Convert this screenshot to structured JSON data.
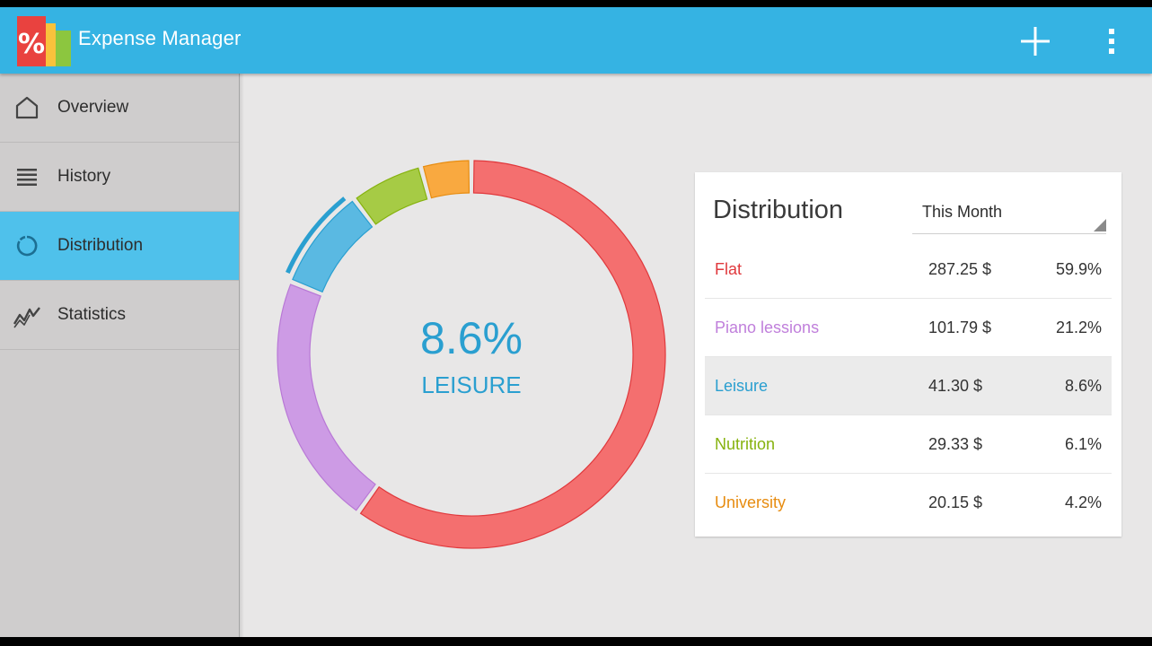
{
  "app": {
    "title": "Expense Manager"
  },
  "colors": {
    "accent": "#35b3e3",
    "active_nav": "#4fc1eb",
    "flat": "#f46f6f",
    "piano": "#cd9be5",
    "leisure": "#5ab9e2",
    "nutrition": "#a6cb45",
    "university": "#f9a940"
  },
  "toolbar": {
    "add_icon": "plus-icon",
    "menu_icon": "overflow-menu-icon"
  },
  "nav": {
    "items": [
      {
        "label": "Overview",
        "icon": "home-icon",
        "active": false
      },
      {
        "label": "History",
        "icon": "list-icon",
        "active": false
      },
      {
        "label": "Distribution",
        "icon": "donut-icon",
        "active": true
      },
      {
        "label": "Statistics",
        "icon": "trend-icon",
        "active": false
      }
    ]
  },
  "center": {
    "percent": "8.6%",
    "label": "LEISURE"
  },
  "distribution": {
    "title": "Distribution",
    "period": "This Month",
    "rows": [
      {
        "name": "Flat",
        "amount": "287.25 $",
        "percent": "59.9%",
        "color": "#e0393d",
        "selected": false
      },
      {
        "name": "Piano lessions",
        "amount": "101.79 $",
        "percent": "21.2%",
        "color": "#c07fdb",
        "selected": false
      },
      {
        "name": "Leisure",
        "amount": "41.30 $",
        "percent": "8.6%",
        "color": "#2a9fd0",
        "selected": true
      },
      {
        "name": "Nutrition",
        "amount": "29.33 $",
        "percent": "6.1%",
        "color": "#86b20e",
        "selected": false
      },
      {
        "name": "University",
        "amount": "20.15 $",
        "percent": "4.2%",
        "color": "#e78c10",
        "selected": false
      }
    ]
  },
  "chart_data": {
    "type": "pie",
    "categories": [
      "Flat",
      "Piano lessions",
      "Leisure",
      "Nutrition",
      "University"
    ],
    "values": [
      59.9,
      21.2,
      8.6,
      6.1,
      4.2
    ],
    "highlighted": "Leisure"
  }
}
